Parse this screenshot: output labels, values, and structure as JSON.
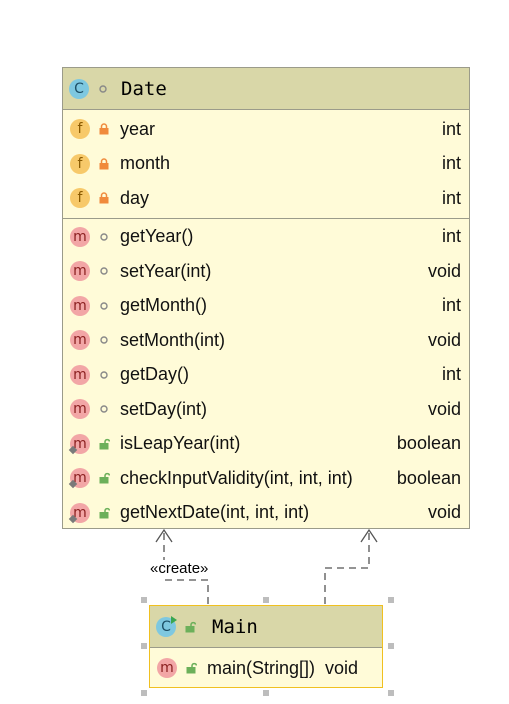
{
  "date_class": {
    "name": "Date",
    "fields": [
      {
        "name": "year",
        "type": "int"
      },
      {
        "name": "month",
        "type": "int"
      },
      {
        "name": "day",
        "type": "int"
      }
    ],
    "methods": [
      {
        "name": "getYear()",
        "type": "int",
        "visibility": "package"
      },
      {
        "name": "setYear(int)",
        "type": "void",
        "visibility": "package"
      },
      {
        "name": "getMonth()",
        "type": "int",
        "visibility": "package"
      },
      {
        "name": "setMonth(int)",
        "type": "void",
        "visibility": "package"
      },
      {
        "name": "getDay()",
        "type": "int",
        "visibility": "package"
      },
      {
        "name": "setDay(int)",
        "type": "void",
        "visibility": "package"
      },
      {
        "name": "isLeapYear(int)",
        "type": "boolean",
        "visibility": "public-static"
      },
      {
        "name": "checkInputValidity(int, int, int)",
        "type": "boolean",
        "visibility": "public-static"
      },
      {
        "name": "getNextDate(int, int, int)",
        "type": "void",
        "visibility": "public-static"
      }
    ]
  },
  "main_class": {
    "name": "Main",
    "methods": [
      {
        "name": "main(String[])",
        "type": "void",
        "visibility": "public-static"
      }
    ]
  },
  "relation": {
    "stereotype": "«create»"
  },
  "icons": {
    "class_badge": "C",
    "field_badge": "f",
    "method_badge": "m"
  },
  "colors": {
    "header": "#d9d7a8",
    "body": "#fffbd8",
    "selected_border": "#f0c020"
  }
}
